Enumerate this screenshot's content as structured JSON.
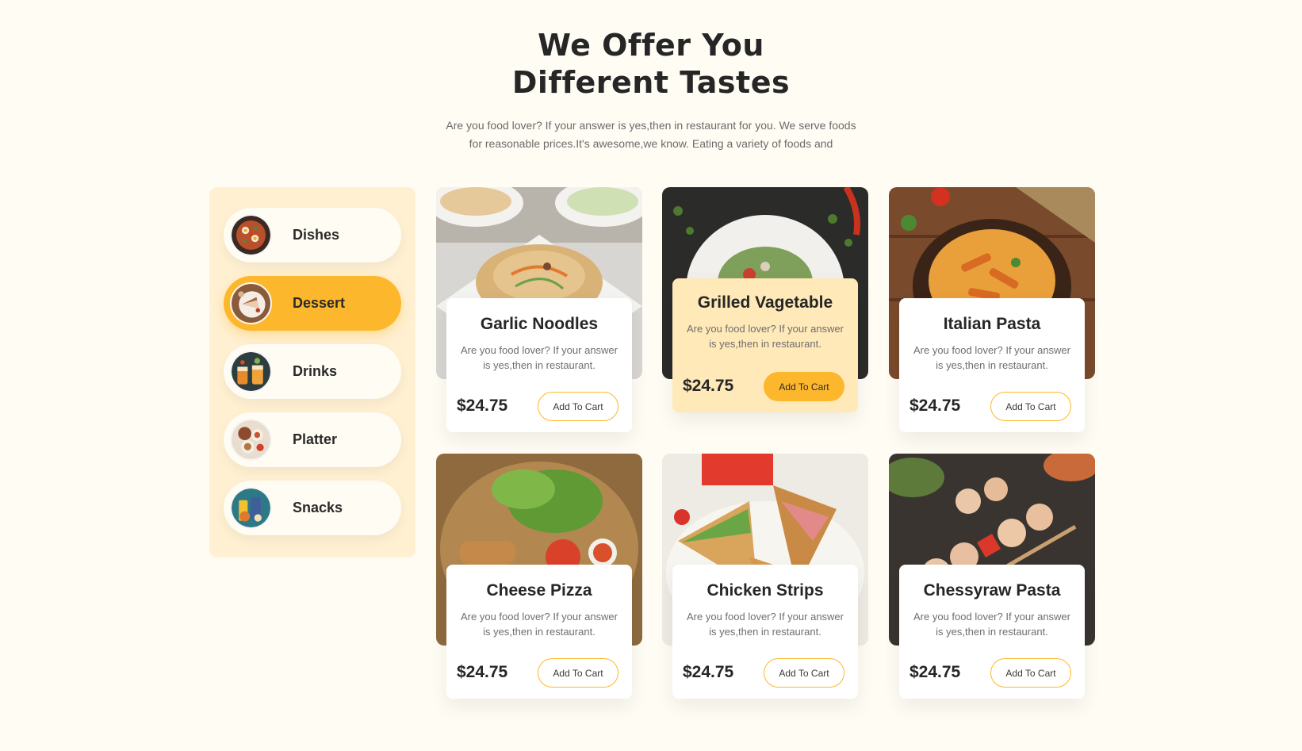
{
  "header": {
    "title_line1": "We Offer You",
    "title_line2": "Different Tastes",
    "subtitle_line1": "Are you food lover? If your answer is yes,then in restaurant for you. We serve foods",
    "subtitle_line2": "for reasonable prices.It's awesome,we know. Eating a variety of foods and"
  },
  "categories": [
    {
      "label": "Dishes",
      "active": false
    },
    {
      "label": "Dessert",
      "active": true
    },
    {
      "label": "Drinks",
      "active": false
    },
    {
      "label": "Platter",
      "active": false
    },
    {
      "label": "Snacks",
      "active": false
    }
  ],
  "products": [
    {
      "name": "Garlic Noodles",
      "desc": "Are you food lover? If your answer is yes,then in restaurant.",
      "price": "$24.75",
      "button": "Add To Cart"
    },
    {
      "name": "Grilled Vagetable",
      "desc": "Are you food lover? If your answer is yes,then in restaurant.",
      "price": "$24.75",
      "button": "Add To Cart",
      "featured": true
    },
    {
      "name": "Italian Pasta",
      "desc": "Are you food lover? If your answer is yes,then in restaurant.",
      "price": "$24.75",
      "button": "Add To Cart"
    },
    {
      "name": "Cheese Pizza",
      "desc": "Are you food lover? If your answer is yes,then in restaurant.",
      "price": "$24.75",
      "button": "Add To Cart"
    },
    {
      "name": "Chicken Strips",
      "desc": "Are you food lover? If your answer is yes,then in restaurant.",
      "price": "$24.75",
      "button": "Add To Cart"
    },
    {
      "name": "Chessyraw Pasta",
      "desc": "Are you food lover? If your answer is yes,then in restaurant.",
      "price": "$24.75",
      "button": "Add To Cart"
    }
  ],
  "colors": {
    "background": "#fffcf4",
    "accent": "#fdb72c",
    "sidebar_bg": "#fff0d2",
    "featured_card_bg": "#ffe9b8",
    "text_dark": "#262626",
    "text_muted": "#6e6e6e"
  }
}
